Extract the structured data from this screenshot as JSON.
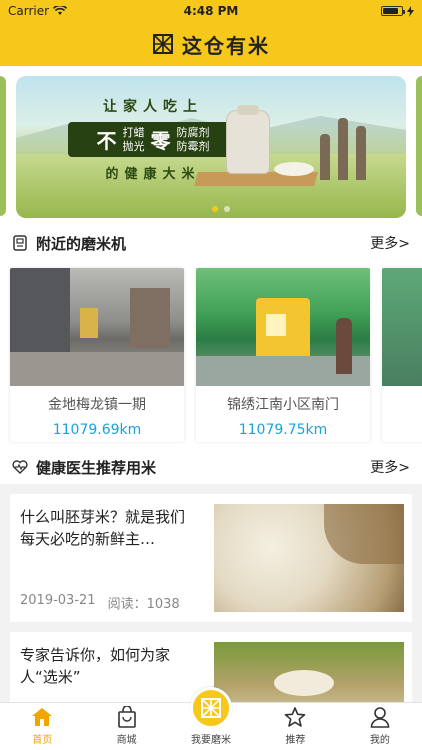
{
  "status_bar": {
    "carrier": "Carrier",
    "time": "4:48 PM",
    "battery_level": 0.85
  },
  "header": {
    "title": "这仓有米",
    "logo_icon": "rice-logo-icon"
  },
  "banner": {
    "slogan_line1": "让家人吃上",
    "slogan_big": "不",
    "slogan_mid_top": "打蜡",
    "slogan_mid_bottom": "抛光",
    "slogan_zero": "零",
    "slogan_right_top": "防腐剂",
    "slogan_right_bottom": "防霉剂",
    "slogan_line3": "的健康大米",
    "page_count": 2,
    "active_page": 0
  },
  "nearby": {
    "title": "附近的磨米机",
    "more": "更多>",
    "items": [
      {
        "name": "金地梅龙镇一期",
        "distance": "11079.69km"
      },
      {
        "name": "锦绣江南小区南门",
        "distance": "11079.75km"
      }
    ]
  },
  "recommend": {
    "title": "健康医生推荐用米",
    "more": "更多>",
    "articles": [
      {
        "title": "什么叫胚芽米？就是我们每天必吃的新鲜主…",
        "date": "2019-03-21",
        "reads": "阅读：1038"
      },
      {
        "title": "专家告诉你，如何为家人“选米”",
        "date": "",
        "reads": ""
      }
    ]
  },
  "tabbar": {
    "items": [
      {
        "label": "首页",
        "icon": "home-icon",
        "active": true
      },
      {
        "label": "商城",
        "icon": "shopping-bag-icon",
        "active": false
      },
      {
        "label": "我要磨米",
        "icon": "rice-mill-icon",
        "active": false
      },
      {
        "label": "推荐",
        "icon": "star-icon",
        "active": false
      },
      {
        "label": "我的",
        "icon": "profile-icon",
        "active": false
      }
    ]
  },
  "colors": {
    "brand_yellow": "#f7c81c",
    "distance_blue": "#1aa3d8",
    "active_tab": "#f0a500"
  }
}
